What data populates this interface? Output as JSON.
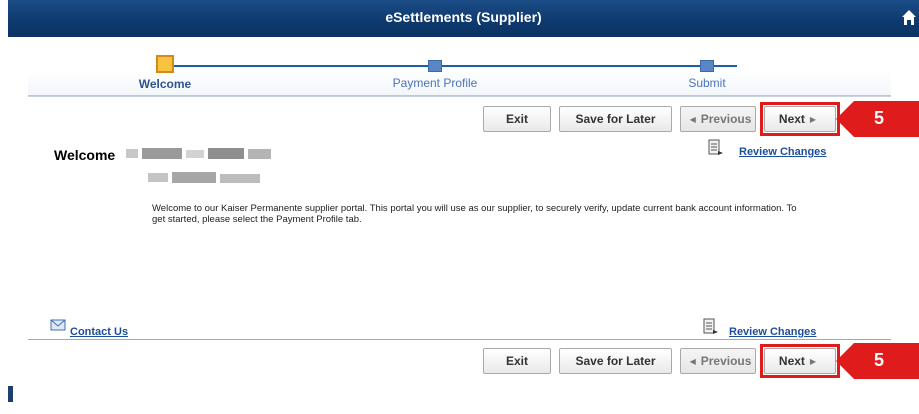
{
  "header": {
    "title": "eSettlements (Supplier)",
    "home_icon": "home-icon"
  },
  "steps": [
    {
      "label": "Welcome",
      "state": "active"
    },
    {
      "label": "Payment Profile",
      "state": "inactive"
    },
    {
      "label": "Submit",
      "state": "inactive"
    }
  ],
  "buttons": {
    "exit": "Exit",
    "save_for_later": "Save for Later",
    "previous": "Previous",
    "next": "Next"
  },
  "callout": {
    "number": "5",
    "color": "#e01b1b"
  },
  "content": {
    "welcome": "Welcome",
    "intro": "Welcome to our Kaiser Permanente supplier portal.  This portal you will use as our supplier, to securely verify, update current bank account information.  To get started, please select the Payment Profile tab."
  },
  "links": {
    "review_changes": "Review Changes",
    "contact_us": "Contact Us"
  },
  "colors": {
    "header": "#0e3a6f",
    "accent": "#1d5ca8",
    "active_step": "#f9c341",
    "link": "#1d4e9a"
  }
}
